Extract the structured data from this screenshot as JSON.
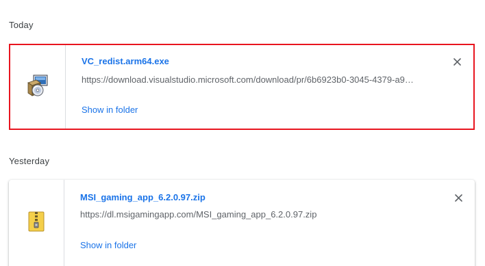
{
  "sections": [
    {
      "label": "Today",
      "download": {
        "file_name": "VC_redist.arm64.exe",
        "url": "https://download.visualstudio.microsoft.com/download/pr/6b6923b0-3045-4379-a9…",
        "action_label": "Show in folder",
        "icon": "installer-icon",
        "highlight_color": "#e8141e"
      }
    },
    {
      "label": "Yesterday",
      "download": {
        "file_name": "MSI_gaming_app_6.2.0.97.zip",
        "url": "https://dl.msigamingapp.com/MSI_gaming_app_6.2.0.97.zip",
        "action_label": "Show in folder",
        "icon": "zip-archive-icon"
      }
    }
  ],
  "colors": {
    "link": "#1a73e8",
    "secondary_text": "#5f6368",
    "section_label": "#3c4043"
  }
}
